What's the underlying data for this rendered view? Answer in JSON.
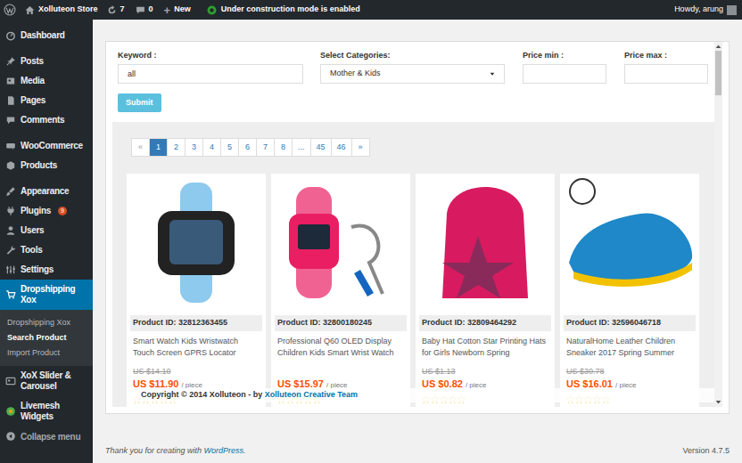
{
  "admin_bar": {
    "site_name": "Xolluteon Store",
    "updates": "7",
    "comments": "0",
    "new_icon": "+",
    "new_label": "New",
    "notice": "Under construction mode is enabled",
    "greeting": "Howdy, arung"
  },
  "sidebar": {
    "groups": [
      [
        {
          "label": "Dashboard",
          "selected": false
        }
      ],
      [
        {
          "label": "Posts",
          "selected": false
        },
        {
          "label": "Media",
          "selected": false
        },
        {
          "label": "Pages",
          "selected": false
        },
        {
          "label": "Comments",
          "selected": false
        }
      ],
      [
        {
          "label": "WooCommerce",
          "selected": false
        },
        {
          "label": "Products",
          "selected": false
        }
      ],
      [
        {
          "label": "Appearance",
          "selected": false
        },
        {
          "label": "Plugins",
          "selected": false,
          "badge": "9"
        },
        {
          "label": "Users",
          "selected": false
        },
        {
          "label": "Tools",
          "selected": false
        },
        {
          "label": "Settings",
          "selected": false
        },
        {
          "label": "Dropshipping Xox",
          "selected": true,
          "submenu": [
            {
              "label": "Dropshipping Xox",
              "selected": false
            },
            {
              "label": "Search Product",
              "selected": true
            },
            {
              "label": "Import Product",
              "selected": false
            }
          ]
        },
        {
          "label": "XoX Slider & Carousel",
          "selected": false
        },
        {
          "label": "Livemesh Widgets",
          "selected": false
        }
      ]
    ],
    "collapse": "Collapse menu"
  },
  "form": {
    "keyword": {
      "label": "Keyword :",
      "value": "all"
    },
    "category": {
      "label": "Select Categories:",
      "value": "Mother & Kids"
    },
    "price_min": {
      "label": "Price min :",
      "value": ""
    },
    "price_max": {
      "label": "Price max :",
      "value": ""
    },
    "submit": "Submit"
  },
  "pagination": [
    {
      "label": "«",
      "selected": false,
      "disabled": true
    },
    {
      "label": "1",
      "selected": true,
      "disabled": false
    },
    {
      "label": "2",
      "selected": false,
      "disabled": false
    },
    {
      "label": "3",
      "selected": false,
      "disabled": false
    },
    {
      "label": "4",
      "selected": false,
      "disabled": false
    },
    {
      "label": "5",
      "selected": false,
      "disabled": false
    },
    {
      "label": "6",
      "selected": false,
      "disabled": false
    },
    {
      "label": "7",
      "selected": false,
      "disabled": false
    },
    {
      "label": "8",
      "selected": false,
      "disabled": false
    },
    {
      "label": "...",
      "selected": false,
      "disabled": false
    },
    {
      "label": "45",
      "selected": false,
      "disabled": false
    },
    {
      "label": "46",
      "selected": false,
      "disabled": false
    },
    {
      "label": "»",
      "selected": false,
      "disabled": false
    }
  ],
  "products": [
    {
      "id_label": "Product ID: 32812363455",
      "title": "Smart Watch Kids Wristwatch Touch Screen GPRS Locator",
      "old_price": "US $14.10",
      "price": "US $11.90",
      "unit": "/ piece",
      "stars": 0
    },
    {
      "id_label": "Product ID: 32800180245",
      "title": "Professional Q60 OLED Display Children Kids Smart Wrist Watch",
      "old_price": "",
      "price": "US $15.97",
      "unit": "/ piece",
      "stars": 0
    },
    {
      "id_label": "Product ID: 32809464292",
      "title": "Baby Hat Cotton Star Printing Hats for Girls Newborn Spring",
      "old_price": "US $1.13",
      "price": "US $0.82",
      "unit": "/ piece",
      "stars": 0
    },
    {
      "id_label": "Product ID: 32596046718",
      "title": "NaturalHome Leather Children Sneaker 2017 Spring Summer",
      "old_price": "US $30.78",
      "price": "US $16.01",
      "unit": "/ piece",
      "stars": 0
    }
  ],
  "copyright": {
    "text": "Copyright © 2014 Xolluteon - by ",
    "link": "Xolluteon Creative Team"
  },
  "footer": {
    "thanks": "Thank you for creating with ",
    "thanks_link": "WordPress",
    "thanks_end": ".",
    "version": "Version 4.7.5"
  }
}
